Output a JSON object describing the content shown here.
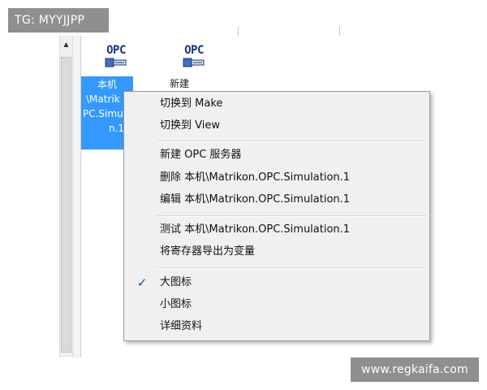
{
  "overlay": {
    "tag": "TG: MYYJJPP",
    "watermark": "www.regkaifa.com"
  },
  "icons": [
    {
      "label_lines": [
        "本机",
        "\\Matrik",
        "PC.Simul",
        "n.1"
      ],
      "icon_text": "OPC",
      "selected": true
    },
    {
      "label_lines": [
        "新建"
      ],
      "icon_text": "OPC",
      "selected": false
    }
  ],
  "context_menu": {
    "groups": [
      [
        {
          "label": "切换到 Make"
        },
        {
          "label": "切换到 View"
        }
      ],
      [
        {
          "label": "新建  OPC 服务器"
        },
        {
          "label": "删除  本机\\Matrikon.OPC.Simulation.1"
        },
        {
          "label": "编辑  本机\\Matrikon.OPC.Simulation.1"
        }
      ],
      [
        {
          "label": "测试  本机\\Matrikon.OPC.Simulation.1"
        },
        {
          "label": "将寄存器导出为变量"
        }
      ],
      [
        {
          "label": "大图标",
          "checked": true,
          "check_mark": "✓"
        },
        {
          "label": "小图标"
        },
        {
          "label": "详细资料"
        }
      ]
    ]
  },
  "colors": {
    "selection": "#3399ff",
    "menu_bg": "#f0f0f0",
    "opc_blue": "#15367a"
  }
}
